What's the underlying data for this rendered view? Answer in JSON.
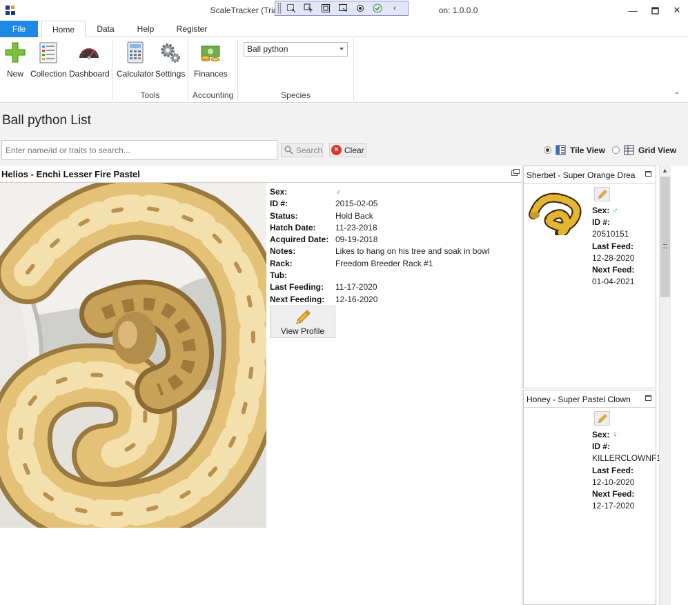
{
  "window": {
    "title": "ScaleTracker (Trial) - Innovati",
    "title_suffix": "on: 1.0.0.0"
  },
  "menu": {
    "file": "File",
    "tabs": [
      "Home",
      "Data",
      "Help",
      "Register"
    ]
  },
  "ribbon": {
    "buttons": {
      "new": "New",
      "collection": "Collection",
      "dashboard": "Dashboard",
      "calculator": "Calculator",
      "settings": "Settings",
      "finances": "Finances"
    },
    "groups": {
      "tools": "Tools",
      "accounting": "Accounting",
      "species": "Species"
    },
    "species_selected": "Ball python"
  },
  "list": {
    "title": "Ball python List",
    "search_placeholder": "Enter name/id or traits to search...",
    "search_label": "Search",
    "clear_label": "Clear",
    "tile_view": "Tile View",
    "grid_view": "Grid View"
  },
  "main_card": {
    "title": "Helios - Enchi Lesser Fire Pastel",
    "details": [
      {
        "label": "Sex:",
        "value": "♂"
      },
      {
        "label": "ID #:",
        "value": "2015-02-05"
      },
      {
        "label": "Status:",
        "value": "Hold Back"
      },
      {
        "label": "Hatch Date:",
        "value": "11-23-2018"
      },
      {
        "label": "Acquired Date:",
        "value": "09-19-2018"
      },
      {
        "label": "Notes:",
        "value": "Likes to hang on his tree and soak in bowl"
      },
      {
        "label": "Rack:",
        "value": "Freedom Breeder Rack #1"
      },
      {
        "label": "Tub:",
        "value": ""
      },
      {
        "label": "Last Feeding:",
        "value": "11-17-2020"
      },
      {
        "label": "Next Feeding:",
        "value": "12-16-2020"
      }
    ],
    "view_profile": "View Profile",
    "colors": {
      "male": "#2f8fd8",
      "female": "#d43fc9"
    }
  },
  "side_cards": [
    {
      "title": "Sherbet - Super Orange Drea",
      "sex_label": "Sex:",
      "sex": "♂",
      "id_label": "ID #:",
      "id": "20510151",
      "last_feed_label": "Last Feed:",
      "last_feed": "12-28-2020",
      "next_feed_label": "Next Feed:",
      "next_feed": "01-04-2021"
    },
    {
      "title": "Honey - Super Pastel Clown",
      "sex_label": "Sex:",
      "sex": "♀",
      "id_label": "ID #:",
      "id": "KILLERCLOWNF1",
      "last_feed_label": "Last Feed:",
      "last_feed": "12-10-2020",
      "next_feed_label": "Next Feed:",
      "next_feed": "12-17-2020"
    }
  ]
}
